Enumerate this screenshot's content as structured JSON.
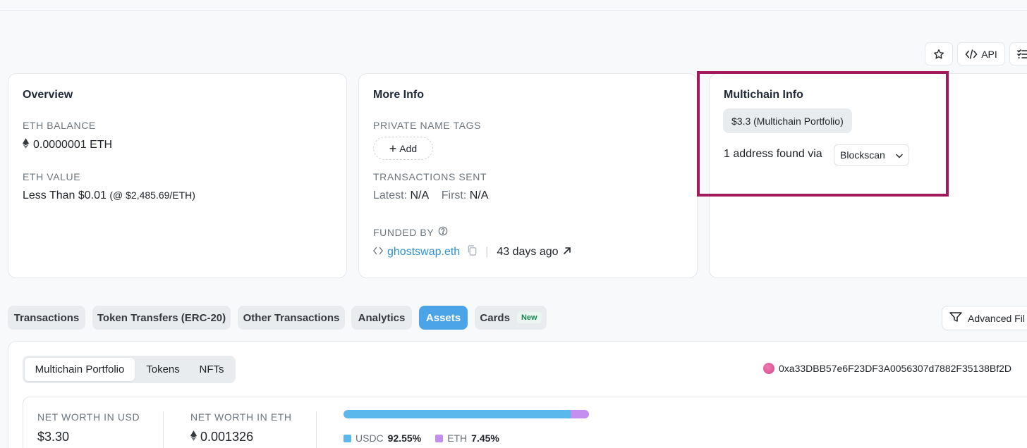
{
  "toolbar": {
    "api_label": "API"
  },
  "overview": {
    "title": "Overview",
    "eth_balance_label": "ETH BALANCE",
    "eth_balance_value": "0.0000001 ETH",
    "eth_value_label": "ETH VALUE",
    "eth_value_main": "Less Than $0.01",
    "eth_value_rate": "(@ $2,485.69/ETH)"
  },
  "more_info": {
    "title": "More Info",
    "private_tags_label": "PRIVATE NAME TAGS",
    "add_label": "Add",
    "tx_sent_label": "TRANSACTIONS SENT",
    "latest_label": "Latest:",
    "latest_value": "N/A",
    "first_label": "First:",
    "first_value": "N/A",
    "funded_by_label": "FUNDED BY",
    "funded_by_name": "ghostswap.eth",
    "funded_age": "43 days ago"
  },
  "multichain": {
    "title": "Multichain Info",
    "portfolio_pill": "$3.3 (Multichain Portfolio)",
    "found_text": "1 address found via",
    "selector_value": "Blockscan"
  },
  "tabs": [
    {
      "label": "Transactions"
    },
    {
      "label": "Token Transfers (ERC-20)"
    },
    {
      "label": "Other Transactions"
    },
    {
      "label": "Analytics"
    },
    {
      "label": "Assets",
      "active": true
    },
    {
      "label": "Cards",
      "badge": "New"
    }
  ],
  "advanced_filter_label": "Advanced Fil",
  "assets": {
    "segments": [
      "Multichain Portfolio",
      "Tokens",
      "NFTs"
    ],
    "active_segment": "Multichain Portfolio",
    "address": "0xa33DBB57e6F23DF3A0056307d7882F35138Bf2D",
    "net_worth_usd_label": "NET WORTH IN USD",
    "net_worth_usd_value": "$3.30",
    "net_worth_eth_label": "NET WORTH IN ETH",
    "net_worth_eth_value": "0.001326",
    "allocation": [
      {
        "name": "USDC",
        "percent_label": "92.55%",
        "percent": 92.55,
        "color": "#5bb8ec"
      },
      {
        "name": "ETH",
        "percent_label": "7.45%",
        "percent": 7.45,
        "color": "#c38ef0"
      }
    ]
  },
  "colors": {
    "accent": "#4ba3e8",
    "highlight_border": "#a21a5d",
    "link": "#2f8fd6"
  }
}
